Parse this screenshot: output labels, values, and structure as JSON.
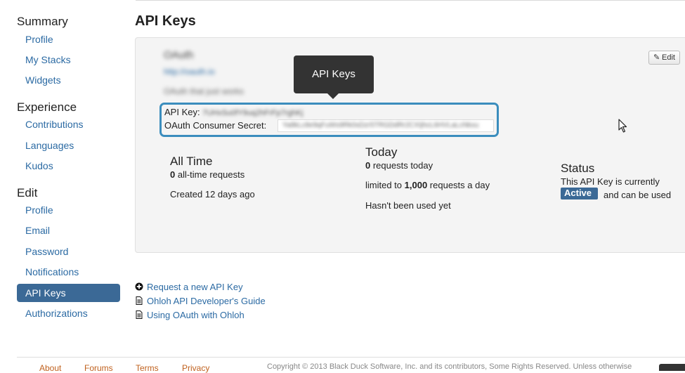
{
  "sidebar": {
    "summary_heading": "Summary",
    "summary_items": [
      "Profile",
      "My Stacks",
      "Widgets"
    ],
    "experience_heading": "Experience",
    "experience_items": [
      "Contributions",
      "Languages",
      "Kudos"
    ],
    "edit_heading": "Edit",
    "edit_items": [
      "Profile",
      "Email",
      "Password",
      "Notifications",
      "API Keys",
      "Authorizations"
    ],
    "active_item": "API Keys"
  },
  "main": {
    "title": "API Keys",
    "app_name": "OAuth",
    "app_url": "http://oauth.io",
    "app_description": "OAuth that just works",
    "edit_label": "Edit",
    "tooltip": "API Keys",
    "api_key_label": "API Key:",
    "api_key_value": "7UHxSu0fY9uq2hFrFp7rghKj",
    "secret_label": "OAuth Consumer Secret:",
    "secret_value": "Ya8kLc8e9qFuWs9Rk0sDzr5TRGDdRr2CXIjhcL6HVLaLcNkxu"
  },
  "stats": {
    "all_time": {
      "heading": "All Time",
      "requests_count": "0",
      "requests_suffix": " all-time requests",
      "created": "Created 12 days ago"
    },
    "today": {
      "heading": "Today",
      "requests_count": "0",
      "requests_suffix": " requests today",
      "limit_prefix": "limited to ",
      "limit_value": "1,000",
      "limit_suffix": " requests a day",
      "last_used": "Hasn't been used yet"
    },
    "status": {
      "heading": "Status",
      "line1": "This API Key is currently",
      "badge": "Active",
      "line2": "and can be used"
    }
  },
  "links": {
    "request_new": "Request a new API Key",
    "dev_guide": "Ohloh API Developer's Guide",
    "oauth_guide": "Using OAuth with Ohloh"
  },
  "footer": {
    "about": "About",
    "forums": "Forums",
    "terms": "Terms",
    "privacy": "Privacy",
    "copyright": "Copyright © 2013 Black Duck Software, Inc. and its contributors, Some Rights Reserved. Unless otherwise"
  },
  "colors": {
    "link": "#2b6aa3",
    "active_nav": "#3b6996",
    "highlight_border": "#3b8dbd",
    "tooltip_bg": "#333333",
    "footer_link": "#c0611e"
  },
  "icons": {
    "edit": "pencil-icon",
    "request": "plus-circle-icon",
    "guide": "document-icon",
    "cursor": "mouse-pointer-icon"
  }
}
